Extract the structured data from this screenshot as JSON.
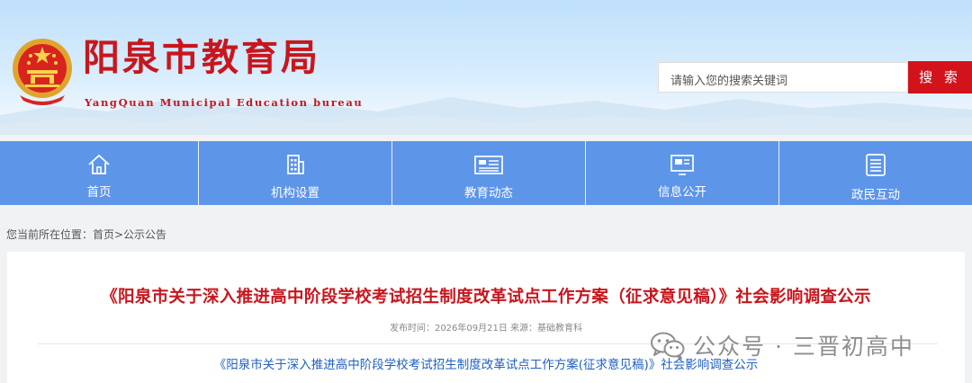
{
  "header": {
    "title": "阳泉市教育局",
    "subtitle": "YangQuan Municipal Education bureau",
    "search_placeholder": "请输入您的搜索关键词",
    "search_button": "搜 索"
  },
  "nav": {
    "items": [
      {
        "label": "首页",
        "icon": "home-icon"
      },
      {
        "label": "机构设置",
        "icon": "building-icon"
      },
      {
        "label": "教育动态",
        "icon": "newspaper-icon"
      },
      {
        "label": "信息公开",
        "icon": "info-board-icon"
      },
      {
        "label": "政民互动",
        "icon": "list-icon"
      }
    ]
  },
  "breadcrumb": {
    "text": "您当前所在位置：首页>公示公告"
  },
  "article": {
    "title": "《阳泉市关于深入推进高中阶段学校考试招生制度改革试点工作方案（征求意见稿）》社会影响调查公示",
    "meta": "发布时间：2026年09月21日 来源：基础教育科",
    "link": "《阳泉市关于深入推进高中阶段学校考试招生制度改革试点工作方案(征求意见稿)》社会影响调查公示"
  },
  "watermark": {
    "text": "公众号 · 三晋初高中",
    "icon": "wechat-icon"
  },
  "colors": {
    "brand_red": "#c8161d",
    "nav_blue": "#5d95e9",
    "search_red": "#d3131c",
    "link_blue": "#2060c0"
  }
}
